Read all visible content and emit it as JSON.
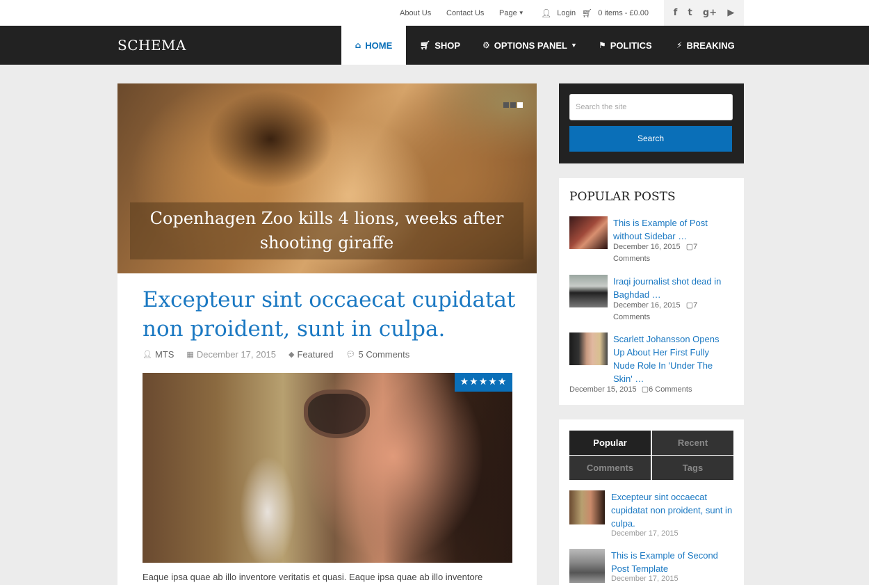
{
  "topbar": {
    "about": "About Us",
    "contact": "Contact Us",
    "page": "Page",
    "login": "Login",
    "cart": "0 items - £0.00",
    "social": [
      "facebook-icon",
      "twitter-icon",
      "google-plus-icon",
      "youtube-icon"
    ]
  },
  "nav": {
    "logo": "SCHEMA",
    "items": [
      {
        "label": "HOME",
        "icon": "home-icon"
      },
      {
        "label": "SHOP",
        "icon": "cart-icon"
      },
      {
        "label": "OPTIONS PANEL",
        "icon": "gears-icon"
      },
      {
        "label": "POLITICS",
        "icon": "flag-icon"
      },
      {
        "label": "BREAKING",
        "icon": "bolt-icon"
      }
    ]
  },
  "slider": {
    "caption": "Copenhagen Zoo kills 4 lions, weeks after shooting giraffe"
  },
  "post": {
    "title": "Excepteur sint occaecat cupidatat non proident, sunt in culpa.",
    "author": "MTS",
    "date": "December 17, 2015",
    "category": "Featured",
    "comments": "5 Comments",
    "rating": "★★★★★",
    "excerpt": "Eaque ipsa quae ab illo inventore veritatis et quasi. Eaque ipsa quae ab illo inventore"
  },
  "search": {
    "placeholder": "Search the site",
    "button": "Search"
  },
  "popular": {
    "title": "POPULAR POSTS",
    "items": [
      {
        "title": "This is Example of Post without Sidebar …",
        "date": "December 16, 2015",
        "comments": "7",
        "comments_label": "Comments"
      },
      {
        "title": "Iraqi journalist shot dead in Baghdad …",
        "date": "December 16, 2015",
        "comments": "7",
        "comments_label": "Comments"
      },
      {
        "title": "Scarlett Johansson Opens Up About Her First Fully Nude Role In 'Under The Skin' …",
        "date": "December 15, 2015",
        "comments": "6 Comments"
      }
    ]
  },
  "tabs": {
    "labels": [
      "Popular",
      "Recent",
      "Comments",
      "Tags"
    ],
    "items": [
      {
        "title": "Excepteur sint occaecat cupidatat non proident, sunt in culpa.",
        "date": "December 17, 2015"
      },
      {
        "title": "This is Example of Second Post Template",
        "date": "December 17, 2015"
      }
    ]
  },
  "colors": {
    "accent": "#0a6fb8",
    "nav_bg": "#222222",
    "link": "#1a78c2"
  }
}
